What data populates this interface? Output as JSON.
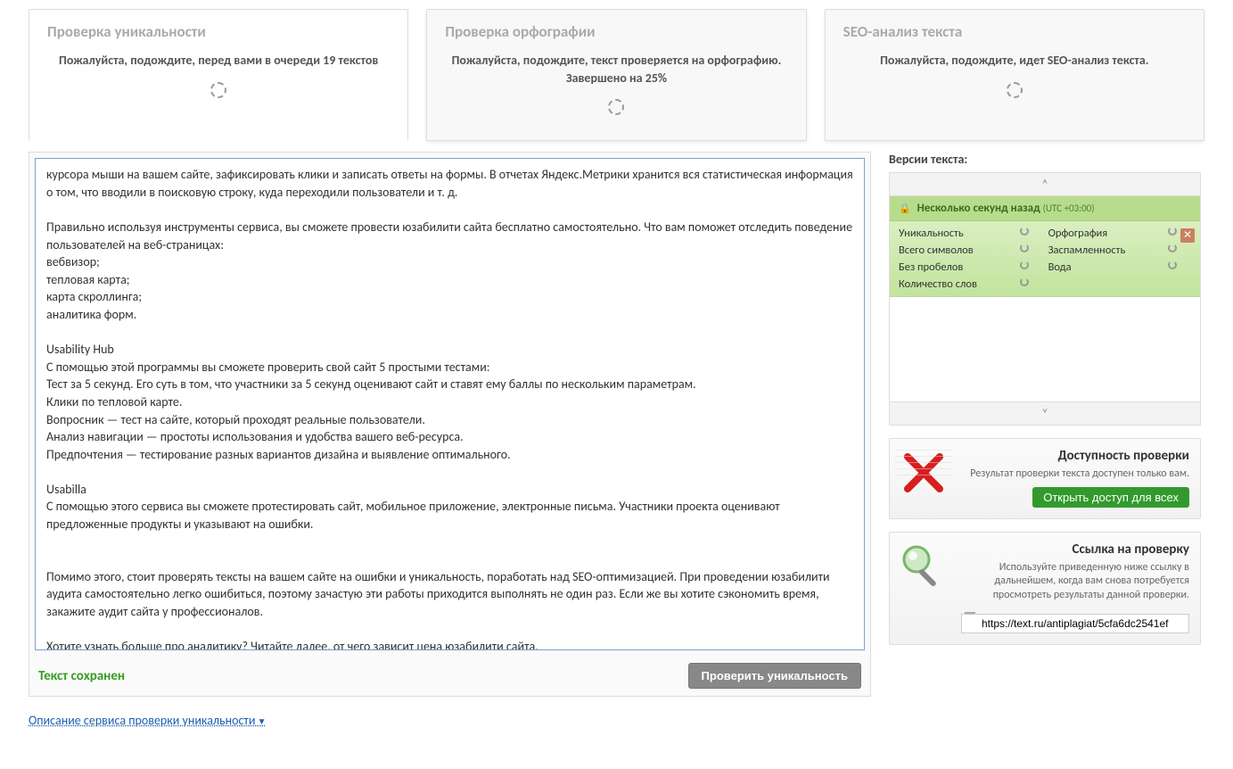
{
  "tabs": {
    "uniq": {
      "title": "Проверка уникальности",
      "msg": "Пожалуйста, подождите, перед вами в очереди 19 текстов"
    },
    "spell": {
      "title": "Проверка орфографии",
      "msg": "Пожалуйста, подождите, текст проверяется на орфографию. Завершено на 25%"
    },
    "seo": {
      "title": "SEO-анализ текста",
      "msg": "Пожалуйста, подождите, идет SEO-анализ текста."
    }
  },
  "editor": {
    "text": "курсора мыши на вашем сайте, зафиксировать клики и записать ответы на формы. В отчетах Яндекс.Метрики хранится вся статистическая информация о том, что вводили в поисковую строку, куда переходили пользователи и т. д.\n\nПравильно используя инструменты сервиса, вы сможете провести юзабилити сайта бесплатно самостоятельно. Что вам поможет отследить поведение пользователей на веб-страницах:\nвебвизор;\nтепловая карта;\nкарта скроллинга;\nаналитика форм.\n\nUsability Hub\nС помощью этой программы вы сможете проверить свой сайт 5 простыми тестами:\nТест за 5 секунд. Его суть в том, что участники за 5 секунд оценивают сайт и ставят ему баллы по нескольким параметрам.\nКлики по тепловой карте.\nВопросник — тест на сайте, который проходят реальные пользователи.\nАнализ навигации — простоты использования и удобства вашего веб-ресурса.\nПредпочтения — тестирование разных вариантов дизайна и выявление оптимального.\n\nUsabilla\nС помощью этого сервиса вы сможете протестировать сайт, мобильное приложение, электронные письма. Участники проекта оценивают предложенные продукты и указывают на ошибки.\n\n\nПомимо этого, стоит проверять тексты на вашем сайте на ошибки и уникальность, поработать над SEO-оптимизацией. При проведении юзабилити аудита самостоятельно легко ошибиться, поэтому зачастую эти работы приходится выполнять не один раз. Если же вы хотите сэкономить время, закажите аудит сайта у профессионалов.\n\nХотите узнать больше про аналитику? Читайте далее, от чего зависит цена юзабилити сайта.",
    "saved": "Текст сохранен",
    "check_btn": "Проверить уникальность"
  },
  "desc_link": "Описание сервиса проверки уникальности",
  "versions": {
    "title": "Версии текста:",
    "item": {
      "time": "Несколько секунд назад",
      "utc": "(UTC +03:00)"
    },
    "metrics": {
      "uniq": "Уникальность",
      "chars": "Всего символов",
      "nosp": "Без пробелов",
      "words": "Количество слов",
      "orth": "Орфография",
      "spam": "Заспамленность",
      "water": "Вода"
    }
  },
  "access": {
    "title": "Доступность проверки",
    "text": "Результат проверки текста доступен только вам.",
    "btn": "Открыть доступ для всех"
  },
  "link": {
    "title": "Ссылка на проверку",
    "text": "Используйте приведенную ниже ссылку в дальнейшем, когда вам снова потребуется просмотреть результаты данной проверки.",
    "url": "https://text.ru/antiplagiat/5cfa6dc2541ef"
  }
}
